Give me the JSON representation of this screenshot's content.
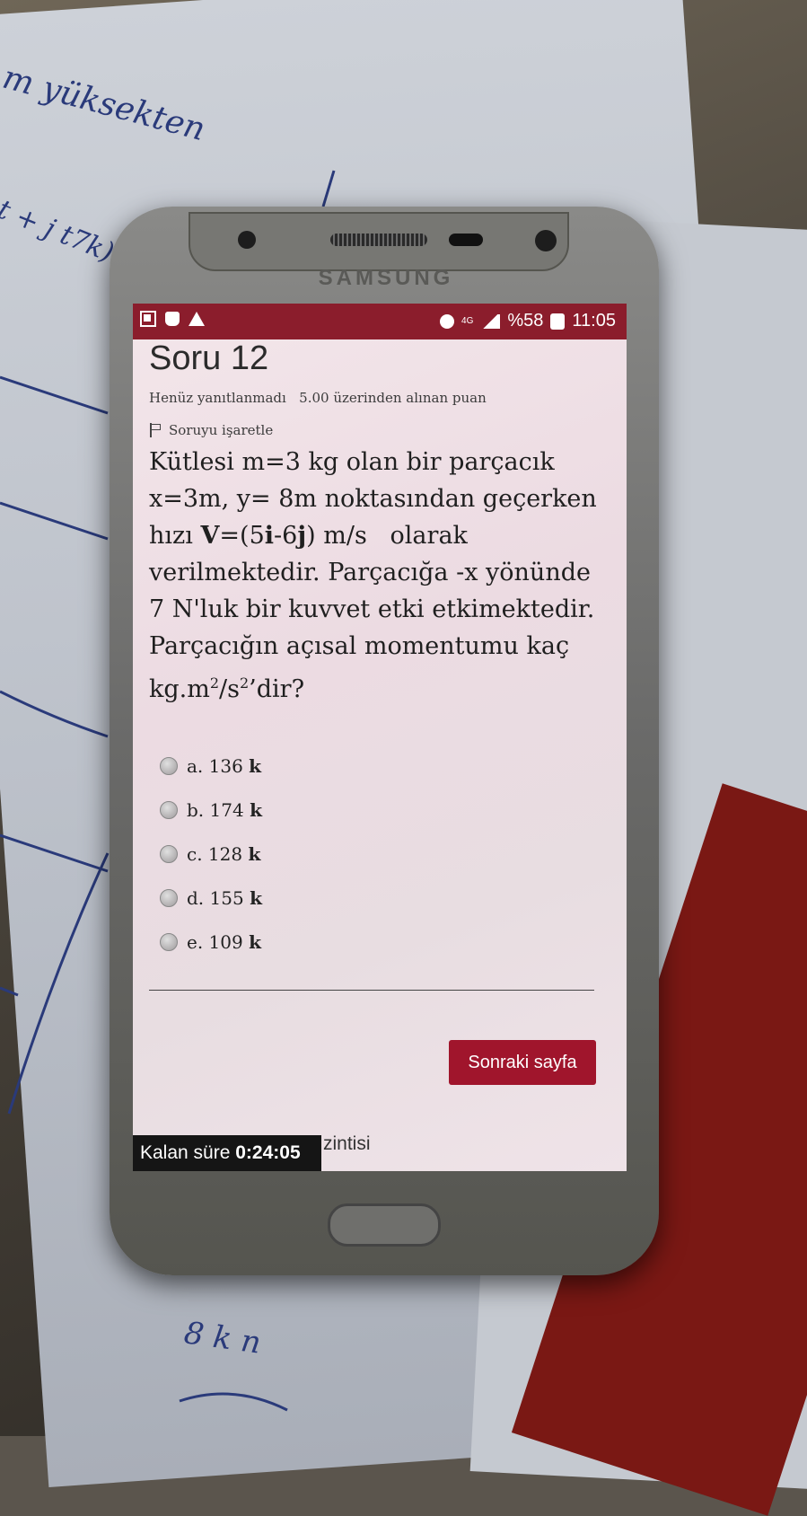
{
  "scene": {
    "handwriting": {
      "top_left": "m yüksekten",
      "left_mid": "t + j t7k)",
      "bottom": "8 k n"
    }
  },
  "phone": {
    "brand": "SAMSUNG",
    "status_bar": {
      "network": "4G",
      "battery": "%58",
      "time": "11:05"
    }
  },
  "quiz": {
    "title": "Soru 12",
    "status_text": "Henüz yanıtlanmadı",
    "points_text": "5.00 üzerinden alınan puan",
    "flag_label": "Soruyu işaretle",
    "question": {
      "line1": "Kütlesi m=3 kg olan bir parçacık",
      "line2": "x=3m, y= 8m noktasından geçerken",
      "line3_prefix": "hızı ",
      "line3_bold_v": "V",
      "line3_mid1": "=(5",
      "line3_bold_i": "i",
      "line3_mid2": "-6",
      "line3_bold_j": "j",
      "line3_suffix": ") m/s   olarak",
      "line4": "verilmektedir. Parçacığa -x yönünde",
      "line5": "7 N'luk bir kuvvet etki etkimektedir.",
      "line6": "Parçacığın açısal momentumu kaç",
      "line7_prefix": "kg.m",
      "line7_sup1": "2",
      "line7_mid": "/s",
      "line7_sup2": "2",
      "line7_suffix": "’dir?"
    },
    "options": [
      {
        "label": "a. 136 ",
        "unit": "k"
      },
      {
        "label": "b. 174 ",
        "unit": "k"
      },
      {
        "label": "c. 128 ",
        "unit": "k"
      },
      {
        "label": "d. 155 ",
        "unit": "k"
      },
      {
        "label": "e. 109 ",
        "unit": "k"
      }
    ],
    "next_button": "Sonraki sayfa",
    "timer_label": "Kalan süre ",
    "timer_value": "0:24:05",
    "partial_text": "zintisi"
  }
}
